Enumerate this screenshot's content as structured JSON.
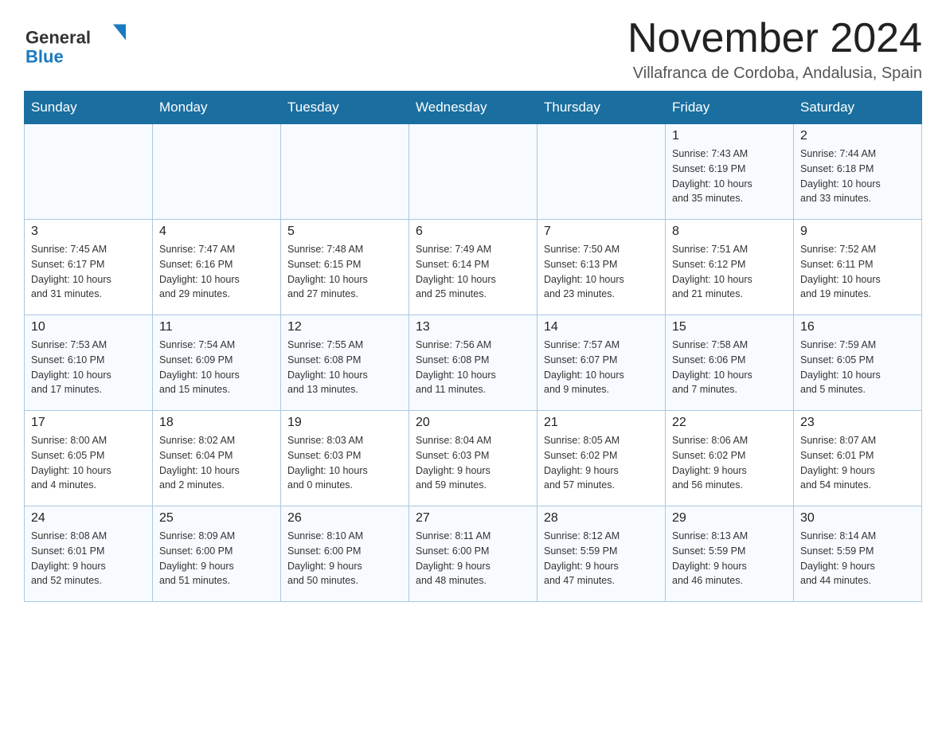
{
  "header": {
    "logo_general": "General",
    "logo_blue": "Blue",
    "month_title": "November 2024",
    "location": "Villafranca de Cordoba, Andalusia, Spain"
  },
  "days_of_week": [
    "Sunday",
    "Monday",
    "Tuesday",
    "Wednesday",
    "Thursday",
    "Friday",
    "Saturday"
  ],
  "weeks": [
    {
      "days": [
        {
          "num": "",
          "info": ""
        },
        {
          "num": "",
          "info": ""
        },
        {
          "num": "",
          "info": ""
        },
        {
          "num": "",
          "info": ""
        },
        {
          "num": "",
          "info": ""
        },
        {
          "num": "1",
          "info": "Sunrise: 7:43 AM\nSunset: 6:19 PM\nDaylight: 10 hours\nand 35 minutes."
        },
        {
          "num": "2",
          "info": "Sunrise: 7:44 AM\nSunset: 6:18 PM\nDaylight: 10 hours\nand 33 minutes."
        }
      ]
    },
    {
      "days": [
        {
          "num": "3",
          "info": "Sunrise: 7:45 AM\nSunset: 6:17 PM\nDaylight: 10 hours\nand 31 minutes."
        },
        {
          "num": "4",
          "info": "Sunrise: 7:47 AM\nSunset: 6:16 PM\nDaylight: 10 hours\nand 29 minutes."
        },
        {
          "num": "5",
          "info": "Sunrise: 7:48 AM\nSunset: 6:15 PM\nDaylight: 10 hours\nand 27 minutes."
        },
        {
          "num": "6",
          "info": "Sunrise: 7:49 AM\nSunset: 6:14 PM\nDaylight: 10 hours\nand 25 minutes."
        },
        {
          "num": "7",
          "info": "Sunrise: 7:50 AM\nSunset: 6:13 PM\nDaylight: 10 hours\nand 23 minutes."
        },
        {
          "num": "8",
          "info": "Sunrise: 7:51 AM\nSunset: 6:12 PM\nDaylight: 10 hours\nand 21 minutes."
        },
        {
          "num": "9",
          "info": "Sunrise: 7:52 AM\nSunset: 6:11 PM\nDaylight: 10 hours\nand 19 minutes."
        }
      ]
    },
    {
      "days": [
        {
          "num": "10",
          "info": "Sunrise: 7:53 AM\nSunset: 6:10 PM\nDaylight: 10 hours\nand 17 minutes."
        },
        {
          "num": "11",
          "info": "Sunrise: 7:54 AM\nSunset: 6:09 PM\nDaylight: 10 hours\nand 15 minutes."
        },
        {
          "num": "12",
          "info": "Sunrise: 7:55 AM\nSunset: 6:08 PM\nDaylight: 10 hours\nand 13 minutes."
        },
        {
          "num": "13",
          "info": "Sunrise: 7:56 AM\nSunset: 6:08 PM\nDaylight: 10 hours\nand 11 minutes."
        },
        {
          "num": "14",
          "info": "Sunrise: 7:57 AM\nSunset: 6:07 PM\nDaylight: 10 hours\nand 9 minutes."
        },
        {
          "num": "15",
          "info": "Sunrise: 7:58 AM\nSunset: 6:06 PM\nDaylight: 10 hours\nand 7 minutes."
        },
        {
          "num": "16",
          "info": "Sunrise: 7:59 AM\nSunset: 6:05 PM\nDaylight: 10 hours\nand 5 minutes."
        }
      ]
    },
    {
      "days": [
        {
          "num": "17",
          "info": "Sunrise: 8:00 AM\nSunset: 6:05 PM\nDaylight: 10 hours\nand 4 minutes."
        },
        {
          "num": "18",
          "info": "Sunrise: 8:02 AM\nSunset: 6:04 PM\nDaylight: 10 hours\nand 2 minutes."
        },
        {
          "num": "19",
          "info": "Sunrise: 8:03 AM\nSunset: 6:03 PM\nDaylight: 10 hours\nand 0 minutes."
        },
        {
          "num": "20",
          "info": "Sunrise: 8:04 AM\nSunset: 6:03 PM\nDaylight: 9 hours\nand 59 minutes."
        },
        {
          "num": "21",
          "info": "Sunrise: 8:05 AM\nSunset: 6:02 PM\nDaylight: 9 hours\nand 57 minutes."
        },
        {
          "num": "22",
          "info": "Sunrise: 8:06 AM\nSunset: 6:02 PM\nDaylight: 9 hours\nand 56 minutes."
        },
        {
          "num": "23",
          "info": "Sunrise: 8:07 AM\nSunset: 6:01 PM\nDaylight: 9 hours\nand 54 minutes."
        }
      ]
    },
    {
      "days": [
        {
          "num": "24",
          "info": "Sunrise: 8:08 AM\nSunset: 6:01 PM\nDaylight: 9 hours\nand 52 minutes."
        },
        {
          "num": "25",
          "info": "Sunrise: 8:09 AM\nSunset: 6:00 PM\nDaylight: 9 hours\nand 51 minutes."
        },
        {
          "num": "26",
          "info": "Sunrise: 8:10 AM\nSunset: 6:00 PM\nDaylight: 9 hours\nand 50 minutes."
        },
        {
          "num": "27",
          "info": "Sunrise: 8:11 AM\nSunset: 6:00 PM\nDaylight: 9 hours\nand 48 minutes."
        },
        {
          "num": "28",
          "info": "Sunrise: 8:12 AM\nSunset: 5:59 PM\nDaylight: 9 hours\nand 47 minutes."
        },
        {
          "num": "29",
          "info": "Sunrise: 8:13 AM\nSunset: 5:59 PM\nDaylight: 9 hours\nand 46 minutes."
        },
        {
          "num": "30",
          "info": "Sunrise: 8:14 AM\nSunset: 5:59 PM\nDaylight: 9 hours\nand 44 minutes."
        }
      ]
    }
  ]
}
